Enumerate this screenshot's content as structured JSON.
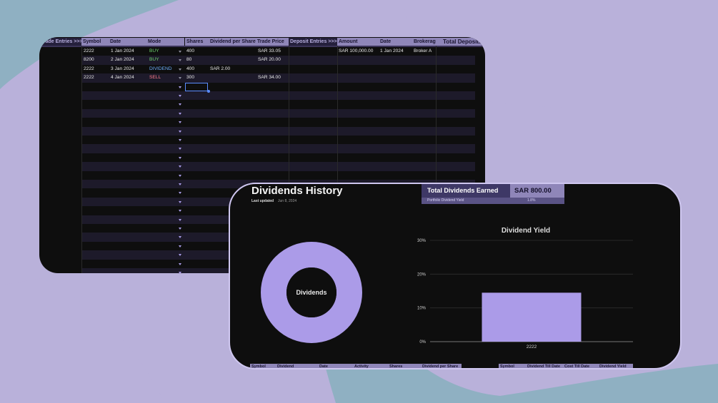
{
  "colors": {
    "background": "#b9b1da",
    "blob": "#8fb0c2",
    "sheet_bg": "#0e0e0e",
    "header_bg": "#8f86b9",
    "header_dark_bg": "#25203c",
    "buy": "#6ed46e",
    "sell": "#ff7a8a",
    "dividend": "#6fb0ff",
    "accent": "#ab9be8",
    "selection": "#5a8cff"
  },
  "sheet": {
    "headers": {
      "trade_entries": "Trade Entries >>>",
      "symbol": "Symbol",
      "date": "Date",
      "mode": "Mode",
      "shares": "Shares",
      "dividend_per_share": "Dividend per Share",
      "trade_price": "Trade Price",
      "deposit_entries": "Deposit Entries >>>",
      "amount": "Amount",
      "deposit_date": "Date",
      "brokerage": "Brokerage",
      "total_deposits": "Total Deposits"
    },
    "trades": [
      {
        "symbol": "2222",
        "date": "1 Jan 2024",
        "mode": "BUY",
        "shares": "400",
        "dps": "",
        "price": "SAR 33.05"
      },
      {
        "symbol": "8200",
        "date": "2 Jan 2024",
        "mode": "BUY",
        "shares": "80",
        "dps": "",
        "price": "SAR 20.00"
      },
      {
        "symbol": "2222",
        "date": "3 Jan 2024",
        "mode": "DIVIDEND",
        "shares": "400",
        "dps": "SAR 2.00",
        "price": ""
      },
      {
        "symbol": "2222",
        "date": "4 Jan 2024",
        "mode": "SELL",
        "shares": "300",
        "dps": "",
        "price": "SAR 34.00"
      }
    ],
    "deposits": [
      {
        "amount": "SAR 100,000.00",
        "date": "1 Jan 2024",
        "brokerage": "Broker A"
      }
    ],
    "dropdown_icon": "chevron-down-icon"
  },
  "dashboard": {
    "title": "Dividends History",
    "last_updated_label": "Last updated",
    "last_updated_value": "Jun 8, 2024",
    "total_label": "Total Dividends Earned",
    "total_value": "SAR 800.00",
    "yield_label": "Portfolio Dividend Yield",
    "yield_value": "1.8%",
    "table1_headers": [
      "Symbol",
      "Dividend",
      "Date",
      "Activity",
      "Shares",
      "Dividend per Share"
    ],
    "table2_headers": [
      "Symbol",
      "Dividend Till Date",
      "Cost Till Date",
      "Dividend Yield"
    ]
  },
  "chart_data": [
    {
      "type": "pie",
      "center_label": "Dividends",
      "slices": [
        {
          "value": 100
        }
      ]
    },
    {
      "type": "bar",
      "title": "Dividend Yield",
      "categories": [
        "2222"
      ],
      "values": [
        14.5
      ],
      "ylim": [
        0,
        30
      ],
      "yticks": [
        0,
        10,
        20,
        30
      ],
      "ytick_labels": [
        "0%",
        "10%",
        "20%",
        "30%"
      ],
      "grid": true
    }
  ]
}
